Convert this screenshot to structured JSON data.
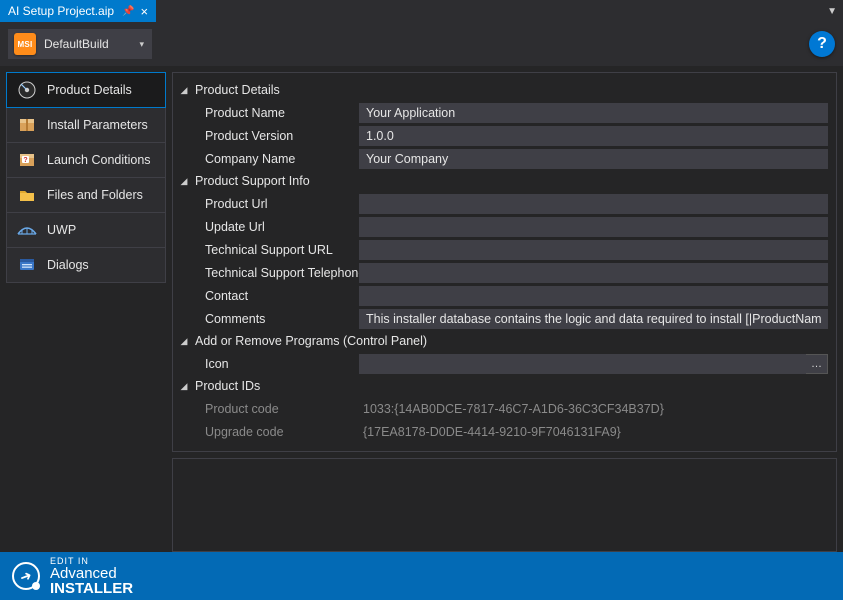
{
  "tab": {
    "title": "AI Setup Project.aip"
  },
  "toolbar": {
    "build_label": "DefaultBuild",
    "msi_badge": "MSI"
  },
  "nav": {
    "items": [
      {
        "label": "Product Details"
      },
      {
        "label": "Install Parameters"
      },
      {
        "label": "Launch Conditions"
      },
      {
        "label": "Files and Folders"
      },
      {
        "label": "UWP"
      },
      {
        "label": "Dialogs"
      }
    ]
  },
  "sections": {
    "product_details": {
      "title": "Product Details",
      "product_name_label": "Product Name",
      "product_name": "Your Application",
      "product_version_label": "Product Version",
      "product_version": "1.0.0",
      "company_name_label": "Company Name",
      "company_name": "Your Company"
    },
    "support": {
      "title": "Product Support Info",
      "product_url_label": "Product Url",
      "product_url": "",
      "update_url_label": "Update Url",
      "update_url": "",
      "tech_url_label": "Technical Support URL",
      "tech_url": "",
      "tech_tel_label": "Technical Support Telephone",
      "tech_tel": "",
      "contact_label": "Contact",
      "contact": "",
      "comments_label": "Comments",
      "comments": "This installer database contains the logic and data required to install [|ProductName]."
    },
    "arp": {
      "title": "Add or Remove Programs (Control Panel)",
      "icon_label": "Icon",
      "icon": ""
    },
    "ids": {
      "title": "Product IDs",
      "product_code_label": "Product code",
      "product_code": "1033:{14AB0DCE-7817-46C7-A1D6-36C3CF34B37D}",
      "upgrade_code_label": "Upgrade code",
      "upgrade_code": "{17EA8178-D0DE-4414-9210-9F7046131FA9}"
    }
  },
  "footer": {
    "small": "EDIT IN",
    "line1": "Advanced",
    "line2": "INSTALLER"
  }
}
